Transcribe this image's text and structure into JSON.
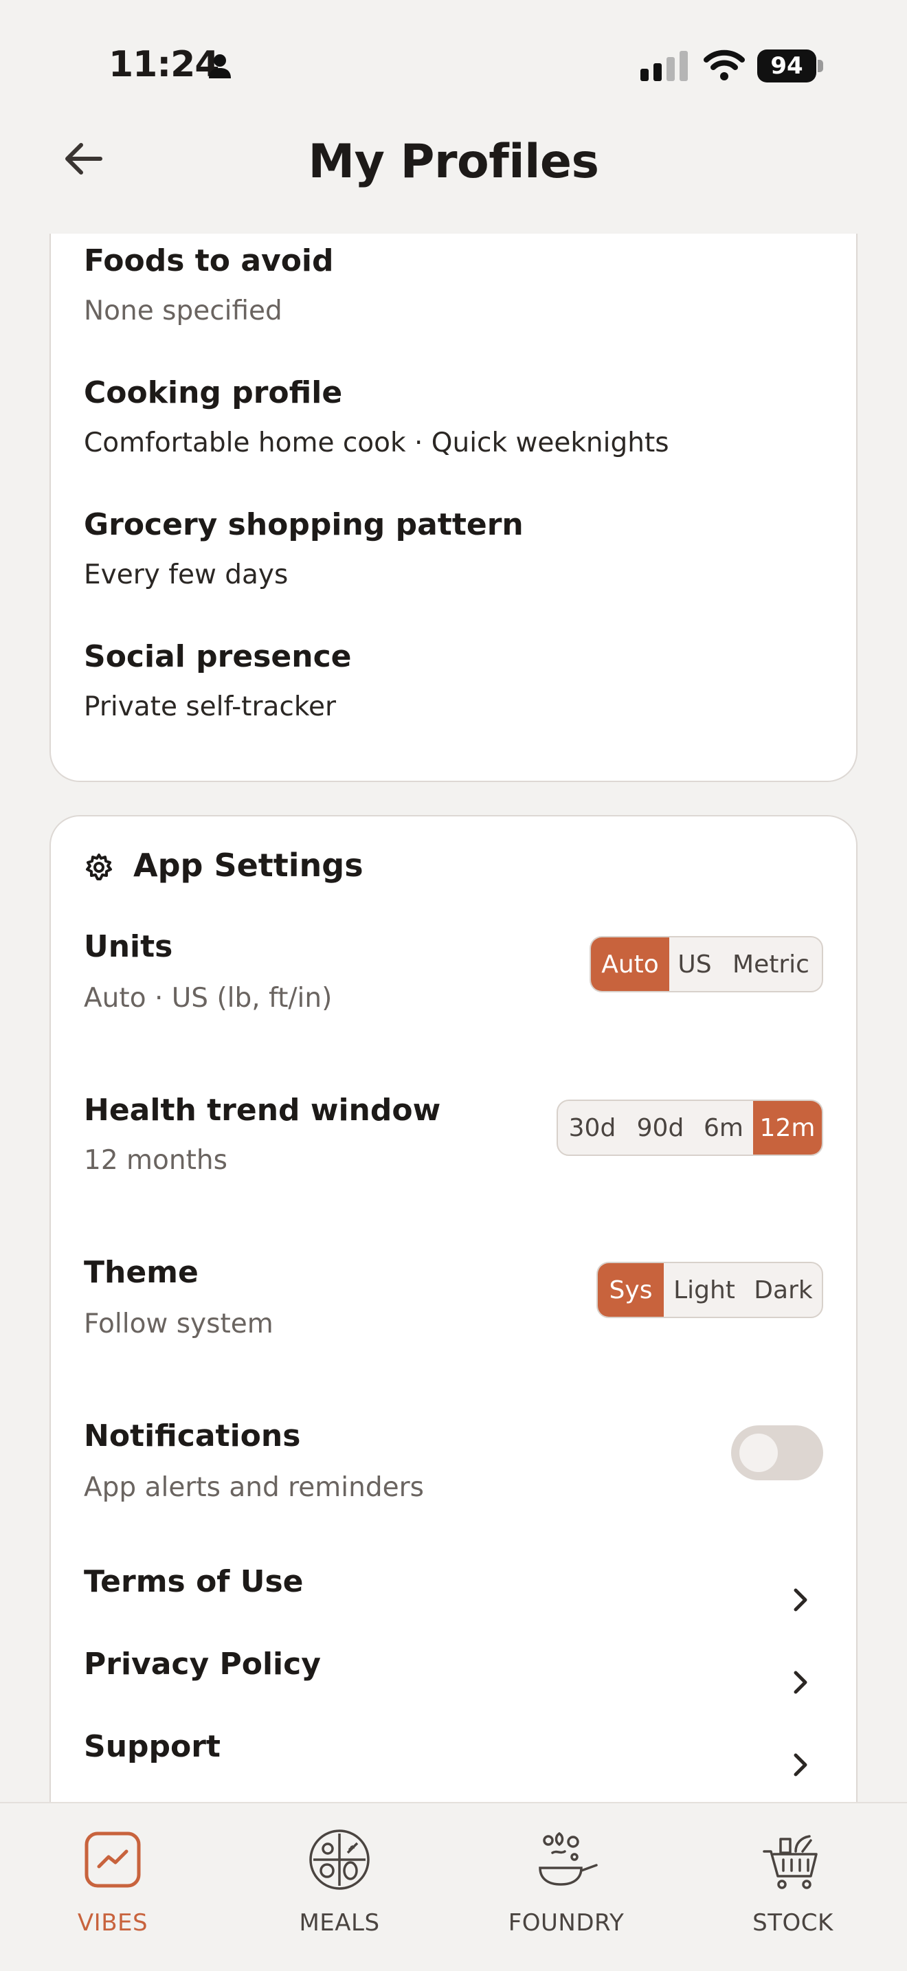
{
  "status_bar": {
    "time": "11:24",
    "battery": "94"
  },
  "header": {
    "title": "My Profiles"
  },
  "profile": {
    "rows": [
      {
        "title": "Foods to avoid",
        "value": "None specified"
      },
      {
        "title": "Cooking profile",
        "value": "Comfortable home cook · Quick weeknights"
      },
      {
        "title": "Grocery shopping pattern",
        "value": "Every few days"
      },
      {
        "title": "Social presence",
        "value": "Private self-tracker"
      }
    ]
  },
  "settings": {
    "heading": "App Settings",
    "units": {
      "title": "Units",
      "value": "Auto · US (lb, ft/in)",
      "options": [
        "Auto",
        "US",
        "Metric"
      ],
      "selected": "Auto"
    },
    "trend": {
      "title": "Health trend window",
      "value": "12 months",
      "options": [
        "30d",
        "90d",
        "6m",
        "12m"
      ],
      "selected": "12m"
    },
    "theme": {
      "title": "Theme",
      "value": "Follow system",
      "options": [
        "Sys",
        "Light",
        "Dark"
      ],
      "selected": "Sys"
    },
    "notifications": {
      "title": "Notifications",
      "value": "App alerts and reminders",
      "enabled": false
    },
    "links": [
      "Terms of Use",
      "Privacy Policy",
      "Support"
    ]
  },
  "nav": {
    "items": [
      {
        "label": "VIBES",
        "icon": "vibes-chart-icon",
        "active": true
      },
      {
        "label": "MEALS",
        "icon": "meals-plate-icon",
        "active": false
      },
      {
        "label": "FOUNDRY",
        "icon": "foundry-pan-icon",
        "active": false
      },
      {
        "label": "STOCK",
        "icon": "stock-cart-icon",
        "active": false
      }
    ]
  },
  "colors": {
    "accent": "#c8633d",
    "background": "#f3f2f0",
    "card": "#ffffff"
  }
}
